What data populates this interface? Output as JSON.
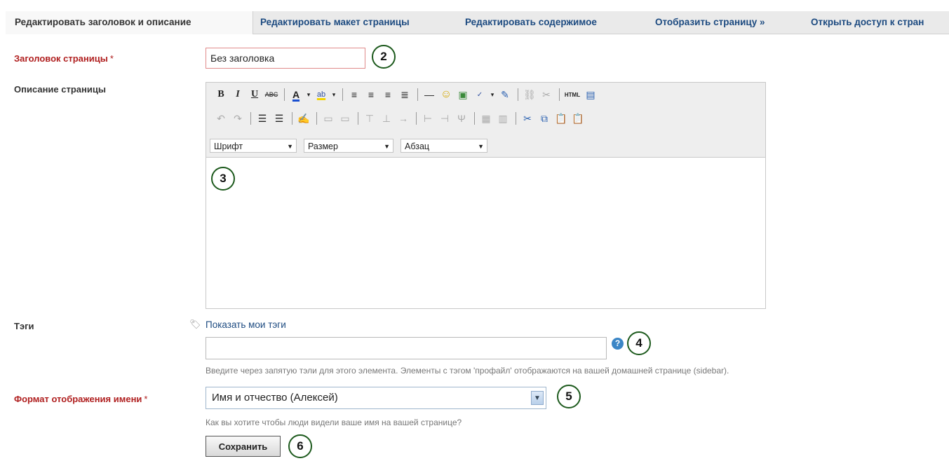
{
  "tabs": [
    {
      "label": "Редактировать заголовок и описание",
      "active": true
    },
    {
      "label": "Редактировать макет страницы",
      "active": false
    },
    {
      "label": "Редактировать содержимое",
      "active": false
    },
    {
      "label": "Отобразить страницу »",
      "active": false
    },
    {
      "label": "Открыть доступ к стран",
      "active": false
    }
  ],
  "title_field": {
    "label": "Заголовок страницы",
    "required_mark": "*",
    "value": "Без заголовка"
  },
  "description_field": {
    "label": "Описание страницы"
  },
  "editor": {
    "font_select": "Шрифт",
    "size_select": "Размер",
    "format_select": "Абзац"
  },
  "tags_field": {
    "label": "Тэги",
    "show_tags_link": "Показать мои тэги",
    "value": "",
    "hint": "Введите через запятую тэли для этого элемента. Элементы с тэгом 'профайл' отображаются на вашей домашней странице (sidebar)."
  },
  "name_format_field": {
    "label": "Формат отображения имени",
    "required_mark": "*",
    "selected": "Имя и отчество (Алексей)",
    "hint": "Как вы хотите чтобы люди видели ваше имя на вашей странице?"
  },
  "save_button": {
    "label": "Сохранить"
  },
  "callouts": [
    "2",
    "3",
    "4",
    "5",
    "6"
  ],
  "colors": {
    "link": "#1c4a80",
    "required": "#b02020",
    "callout_border": "#1d5a1d"
  }
}
